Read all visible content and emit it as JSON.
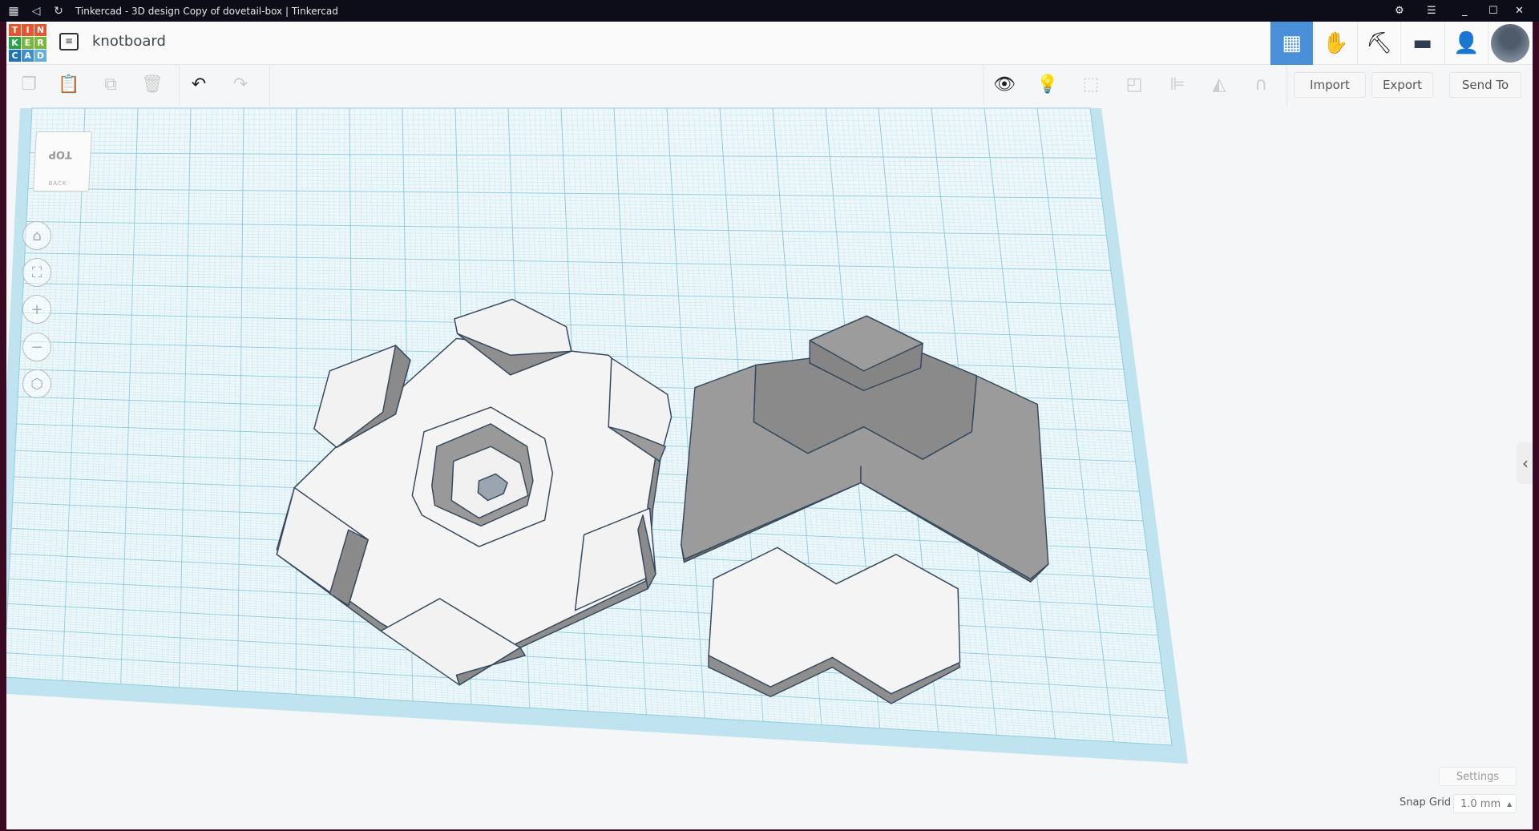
{
  "window": {
    "title": "Tinkercad - 3D design Copy of dovetail-box | Tinkercad"
  },
  "header": {
    "logo_letters": [
      "T",
      "I",
      "N",
      "K",
      "E",
      "R",
      "C",
      "A",
      "D"
    ],
    "logo_colors": [
      "#e8542d",
      "#e8542d",
      "#e8542d",
      "#29a34a",
      "#78b93d",
      "#78b93d",
      "#1f73b7",
      "#3d8fd1",
      "#62b0e0"
    ],
    "project_name": "knotboard",
    "accent": "#4a90d9"
  },
  "toolbar": {
    "import_label": "Import",
    "export_label": "Export",
    "send_to_label": "Send To"
  },
  "viewcube": {
    "top_label": "TOP",
    "back_label": "BACK"
  },
  "footer": {
    "settings_label": "Settings",
    "snap_grid_label": "Snap Grid",
    "snap_grid_value": "1.0 mm"
  }
}
